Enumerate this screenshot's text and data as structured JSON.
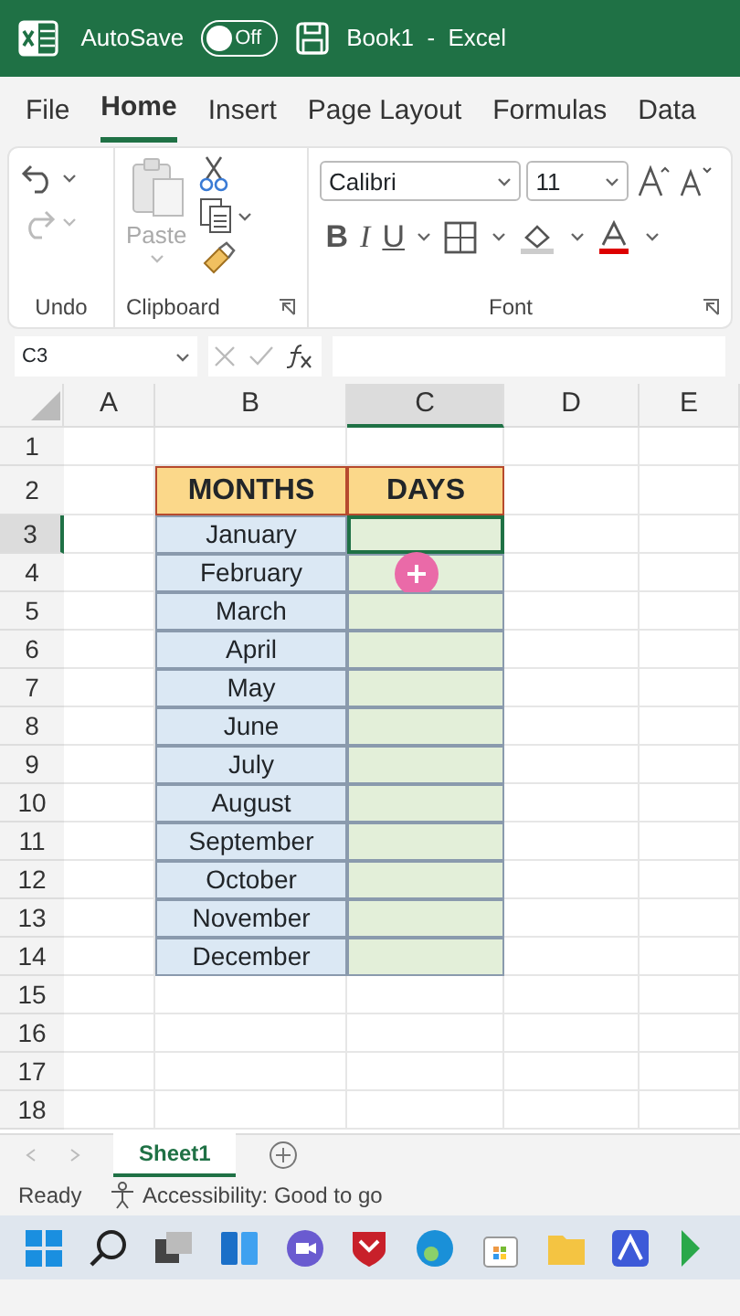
{
  "title_bar": {
    "autosave_label": "AutoSave",
    "autosave_on": false,
    "toggle_text": "Off",
    "title": "Book1  -  Excel"
  },
  "tabs": [
    {
      "label": "File",
      "selected": false
    },
    {
      "label": "Home",
      "selected": true
    },
    {
      "label": "Insert",
      "selected": false
    },
    {
      "label": "Page Layout",
      "selected": false
    },
    {
      "label": "Formulas",
      "selected": false
    },
    {
      "label": "Data",
      "selected": false
    }
  ],
  "ribbon": {
    "groups": [
      "Undo",
      "Clipboard",
      "Font"
    ],
    "paste_label": "Paste",
    "font_name": "Calibri",
    "font_size": "11",
    "bold": "B",
    "italic": "I",
    "underline": "U"
  },
  "formula_bar": {
    "name_box": "C3"
  },
  "columns": [
    {
      "label": "A",
      "selected": false
    },
    {
      "label": "B",
      "selected": false
    },
    {
      "label": "C",
      "selected": true
    },
    {
      "label": "D",
      "selected": false
    },
    {
      "label": "E",
      "selected": false
    }
  ],
  "rows": [
    {
      "number": "1",
      "selected": false,
      "kind": "blank"
    },
    {
      "number": "2",
      "selected": false,
      "kind": "header",
      "cells": [
        "MONTHS",
        "DAYS"
      ]
    },
    {
      "number": "3",
      "selected": true,
      "kind": "entry",
      "month": "January"
    },
    {
      "number": "4",
      "selected": false,
      "kind": "entry",
      "month": "February"
    },
    {
      "number": "5",
      "selected": false,
      "kind": "entry",
      "month": "March"
    },
    {
      "number": "6",
      "selected": false,
      "kind": "entry",
      "month": "April"
    },
    {
      "number": "7",
      "selected": false,
      "kind": "entry",
      "month": "May"
    },
    {
      "number": "8",
      "selected": false,
      "kind": "entry",
      "month": "June"
    },
    {
      "number": "9",
      "selected": false,
      "kind": "entry",
      "month": "July"
    },
    {
      "number": "10",
      "selected": false,
      "kind": "entry",
      "month": "August"
    },
    {
      "number": "11",
      "selected": false,
      "kind": "entry",
      "month": "September"
    },
    {
      "number": "12",
      "selected": false,
      "kind": "entry",
      "month": "October"
    },
    {
      "number": "13",
      "selected": false,
      "kind": "entry",
      "month": "November"
    },
    {
      "number": "14",
      "selected": false,
      "kind": "entry",
      "month": "December"
    },
    {
      "number": "15",
      "selected": false,
      "kind": "blank"
    },
    {
      "number": "16",
      "selected": false,
      "kind": "blank"
    },
    {
      "number": "17",
      "selected": false,
      "kind": "blank"
    },
    {
      "number": "18",
      "selected": false,
      "kind": "blank"
    }
  ],
  "sheet_tabs": [
    {
      "label": "Sheet1",
      "selected": true
    }
  ],
  "status_bar": {
    "ready": "Ready",
    "accessibility": "Accessibility: Good to go"
  }
}
